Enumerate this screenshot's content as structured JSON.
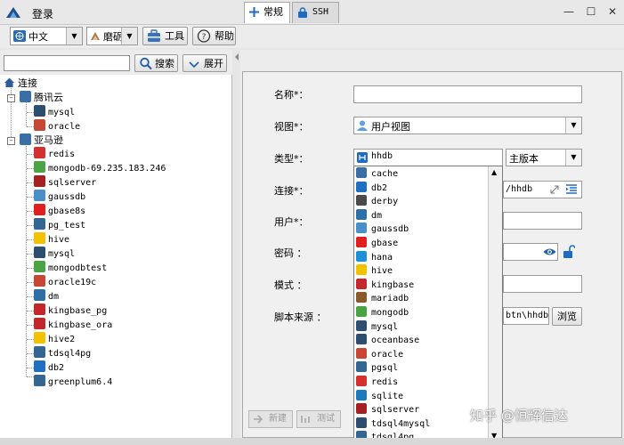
{
  "window": {
    "title": "登录"
  },
  "toolbar": {
    "language": "中文",
    "theme": "磨砺",
    "tools_label": "工具",
    "help_label": "帮助"
  },
  "sidebar": {
    "search_value": "",
    "search_label": "搜索",
    "expand_label": "展开",
    "tree": {
      "root": "连接",
      "groups": [
        {
          "label": "腾讯云",
          "items": [
            "mysql",
            "oracle"
          ]
        },
        {
          "label": "亚马逊",
          "items": [
            "redis",
            "mongodb-69.235.183.246",
            "sqlserver",
            "gaussdb",
            "gbase8s",
            "pg_test",
            "hive",
            "mysql",
            "mongodbtest",
            "oracle19c",
            "dm",
            "kingbase_pg",
            "kingbase_ora",
            "hive2",
            "tdsql4pg",
            "db2",
            "greenplum6.4"
          ]
        }
      ]
    }
  },
  "tabs": [
    {
      "label": "常规",
      "active": true
    },
    {
      "label": "SSH",
      "active": false
    }
  ],
  "form": {
    "name_label": "名称*：",
    "name_value": "",
    "view_label": "视图*：",
    "view_value": "用户视图",
    "type_label": "类型*：",
    "type_value": "hhdb",
    "version_value": "主版本",
    "connect_label": "连接*：",
    "connect_value": "/hhdb",
    "user_label": "用户*：",
    "user_value": "",
    "password_label": "密码 ：",
    "password_value": "",
    "schema_label": "模式 ：",
    "schema_value": "",
    "script_label": "脚本来源 ：",
    "script_value": "btn\\hhdb",
    "browse_label": "浏览",
    "buttons": [
      "新建",
      "测试"
    ]
  },
  "type_dropdown": {
    "options": [
      "cache",
      "db2",
      "derby",
      "dm",
      "gaussdb",
      "gbase",
      "hana",
      "hive",
      "kingbase",
      "mariadb",
      "mongodb",
      "mysql",
      "oceanbase",
      "oracle",
      "pgsql",
      "redis",
      "sqlite",
      "sqlserver",
      "tdsql4mysql",
      "tdsql4pg"
    ]
  },
  "watermark": "知乎 @恒辉信达",
  "colors": {
    "folder": "#3a6ea5",
    "accent_blue": "#1e6bc4",
    "redis": "#d3302f",
    "mongodb": "#4aa443",
    "oracle": "#c74634",
    "gbase": "#e02020",
    "kingbase": "#c3272b"
  }
}
